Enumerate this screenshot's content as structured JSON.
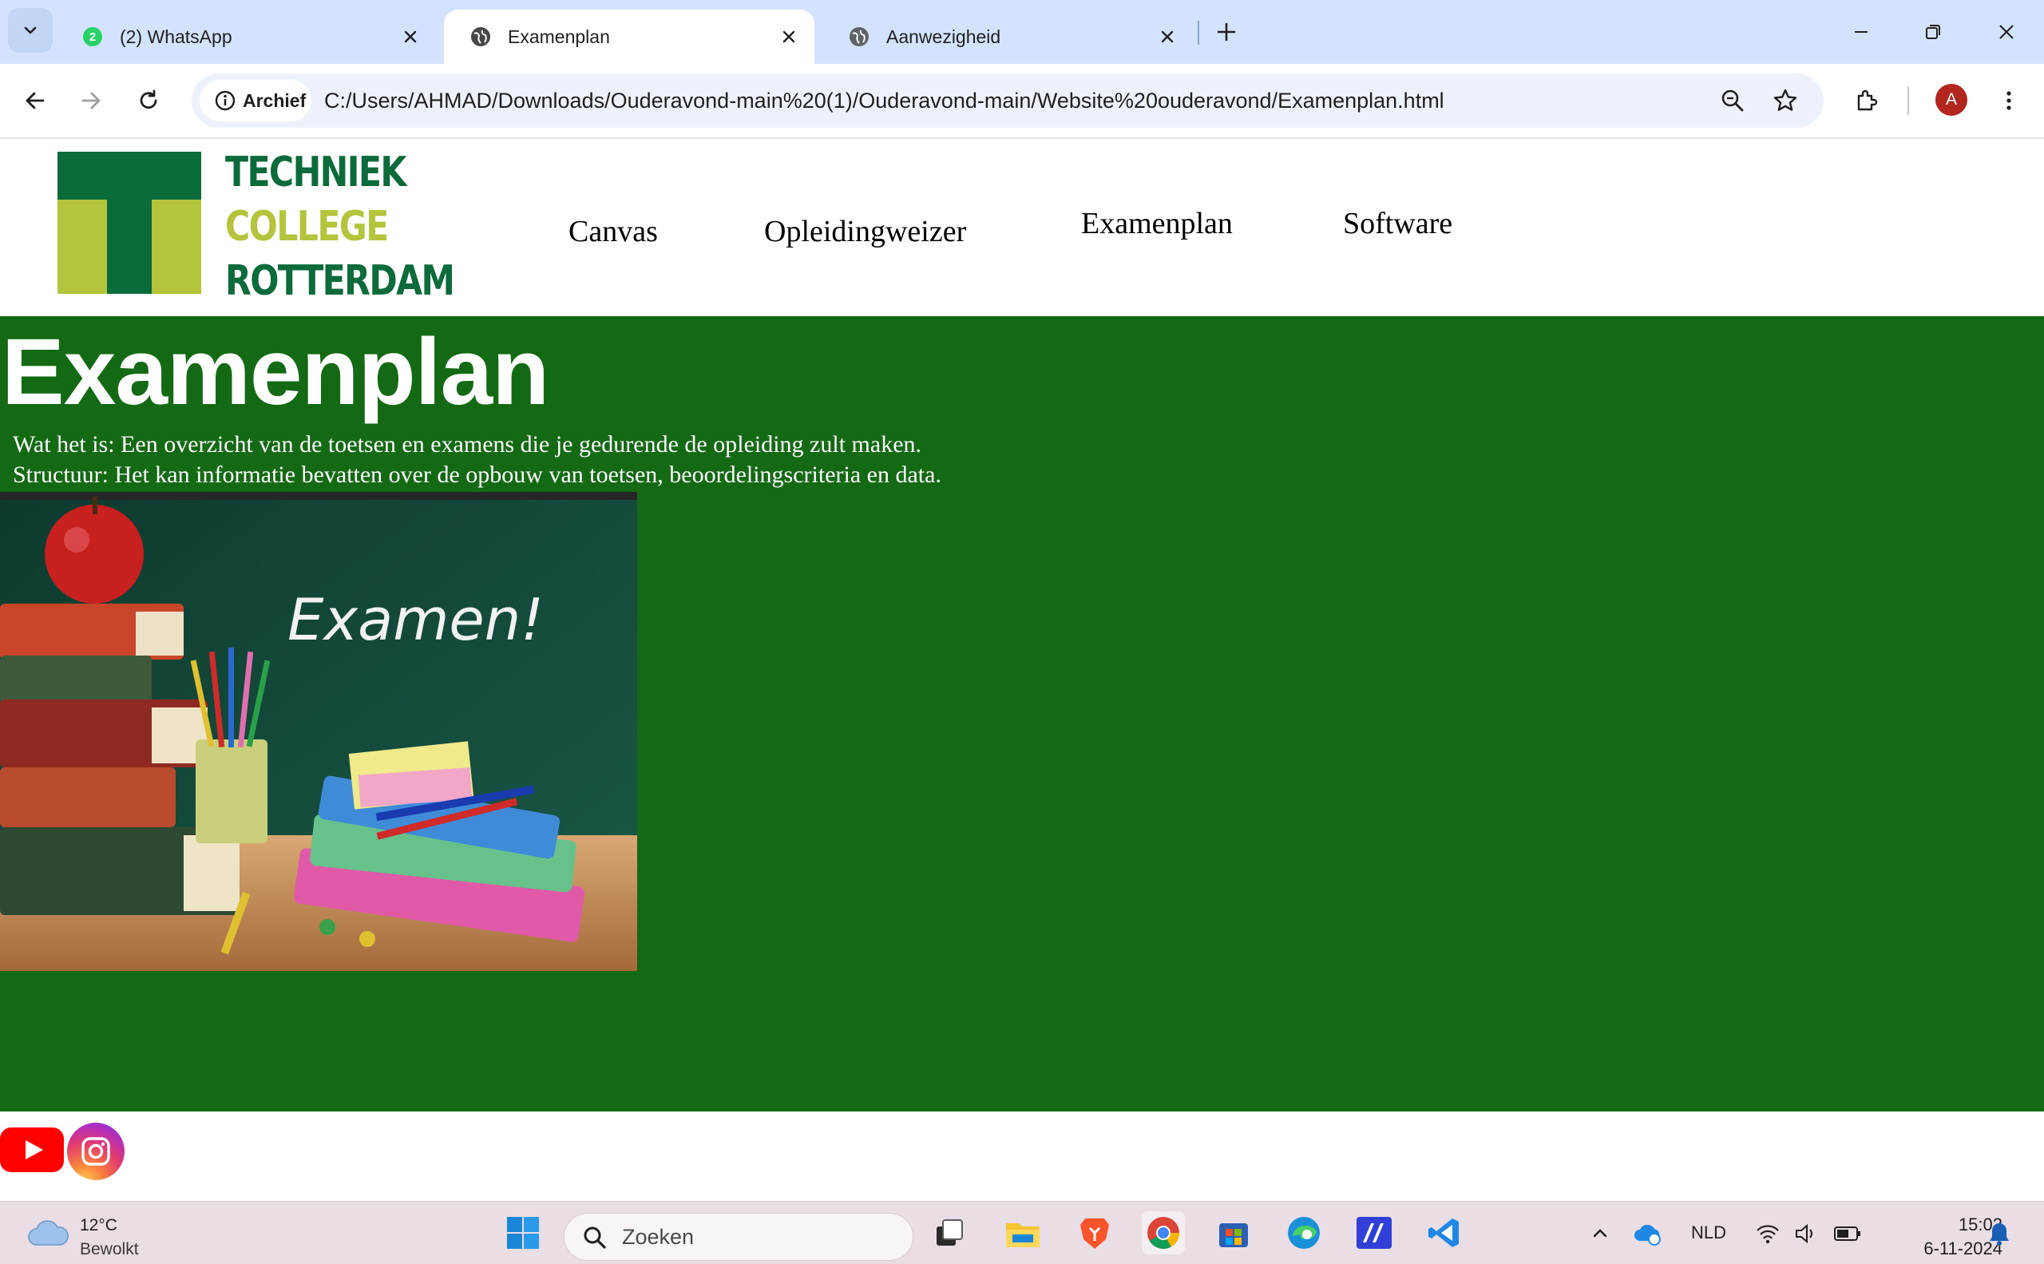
{
  "browser": {
    "tabs": [
      {
        "title": "(2) WhatsApp",
        "badge": "2"
      },
      {
        "title": "Examenplan"
      },
      {
        "title": "Aanwezigheid"
      }
    ],
    "site_info_label": "Archief",
    "url": "C:/Users/AHMAD/Downloads/Ouderavond-main%20(1)/Ouderavond-main/Website%20ouderavond/Examenplan.html",
    "profile_initial": "A"
  },
  "site": {
    "logo": {
      "line1": "TECHNIEK",
      "line2": "COLLEGE",
      "line3": "ROTTERDAM"
    },
    "nav": [
      "Canvas",
      "Opleidingweizer",
      "Examenplan",
      "Software"
    ],
    "title": "Examenplan",
    "description": [
      "Wat het is: Een overzicht van de toetsen en examens die je gedurende de opleiding zult maken.",
      "Structuur: Het kan informatie bevatten over de opbouw van toetsen, beoordelingscriteria en data."
    ],
    "hero_image_text": "Examen!",
    "colors": {
      "main_bg": "#146a14",
      "logo_green": "#0c6b3a",
      "logo_lime": "#b4c43c"
    }
  },
  "taskbar": {
    "weather_temp": "12°C",
    "weather_desc": "Bewolkt",
    "search_placeholder": "Zoeken",
    "language": "NLD",
    "time": "15:02",
    "date": "6-11-2024"
  }
}
